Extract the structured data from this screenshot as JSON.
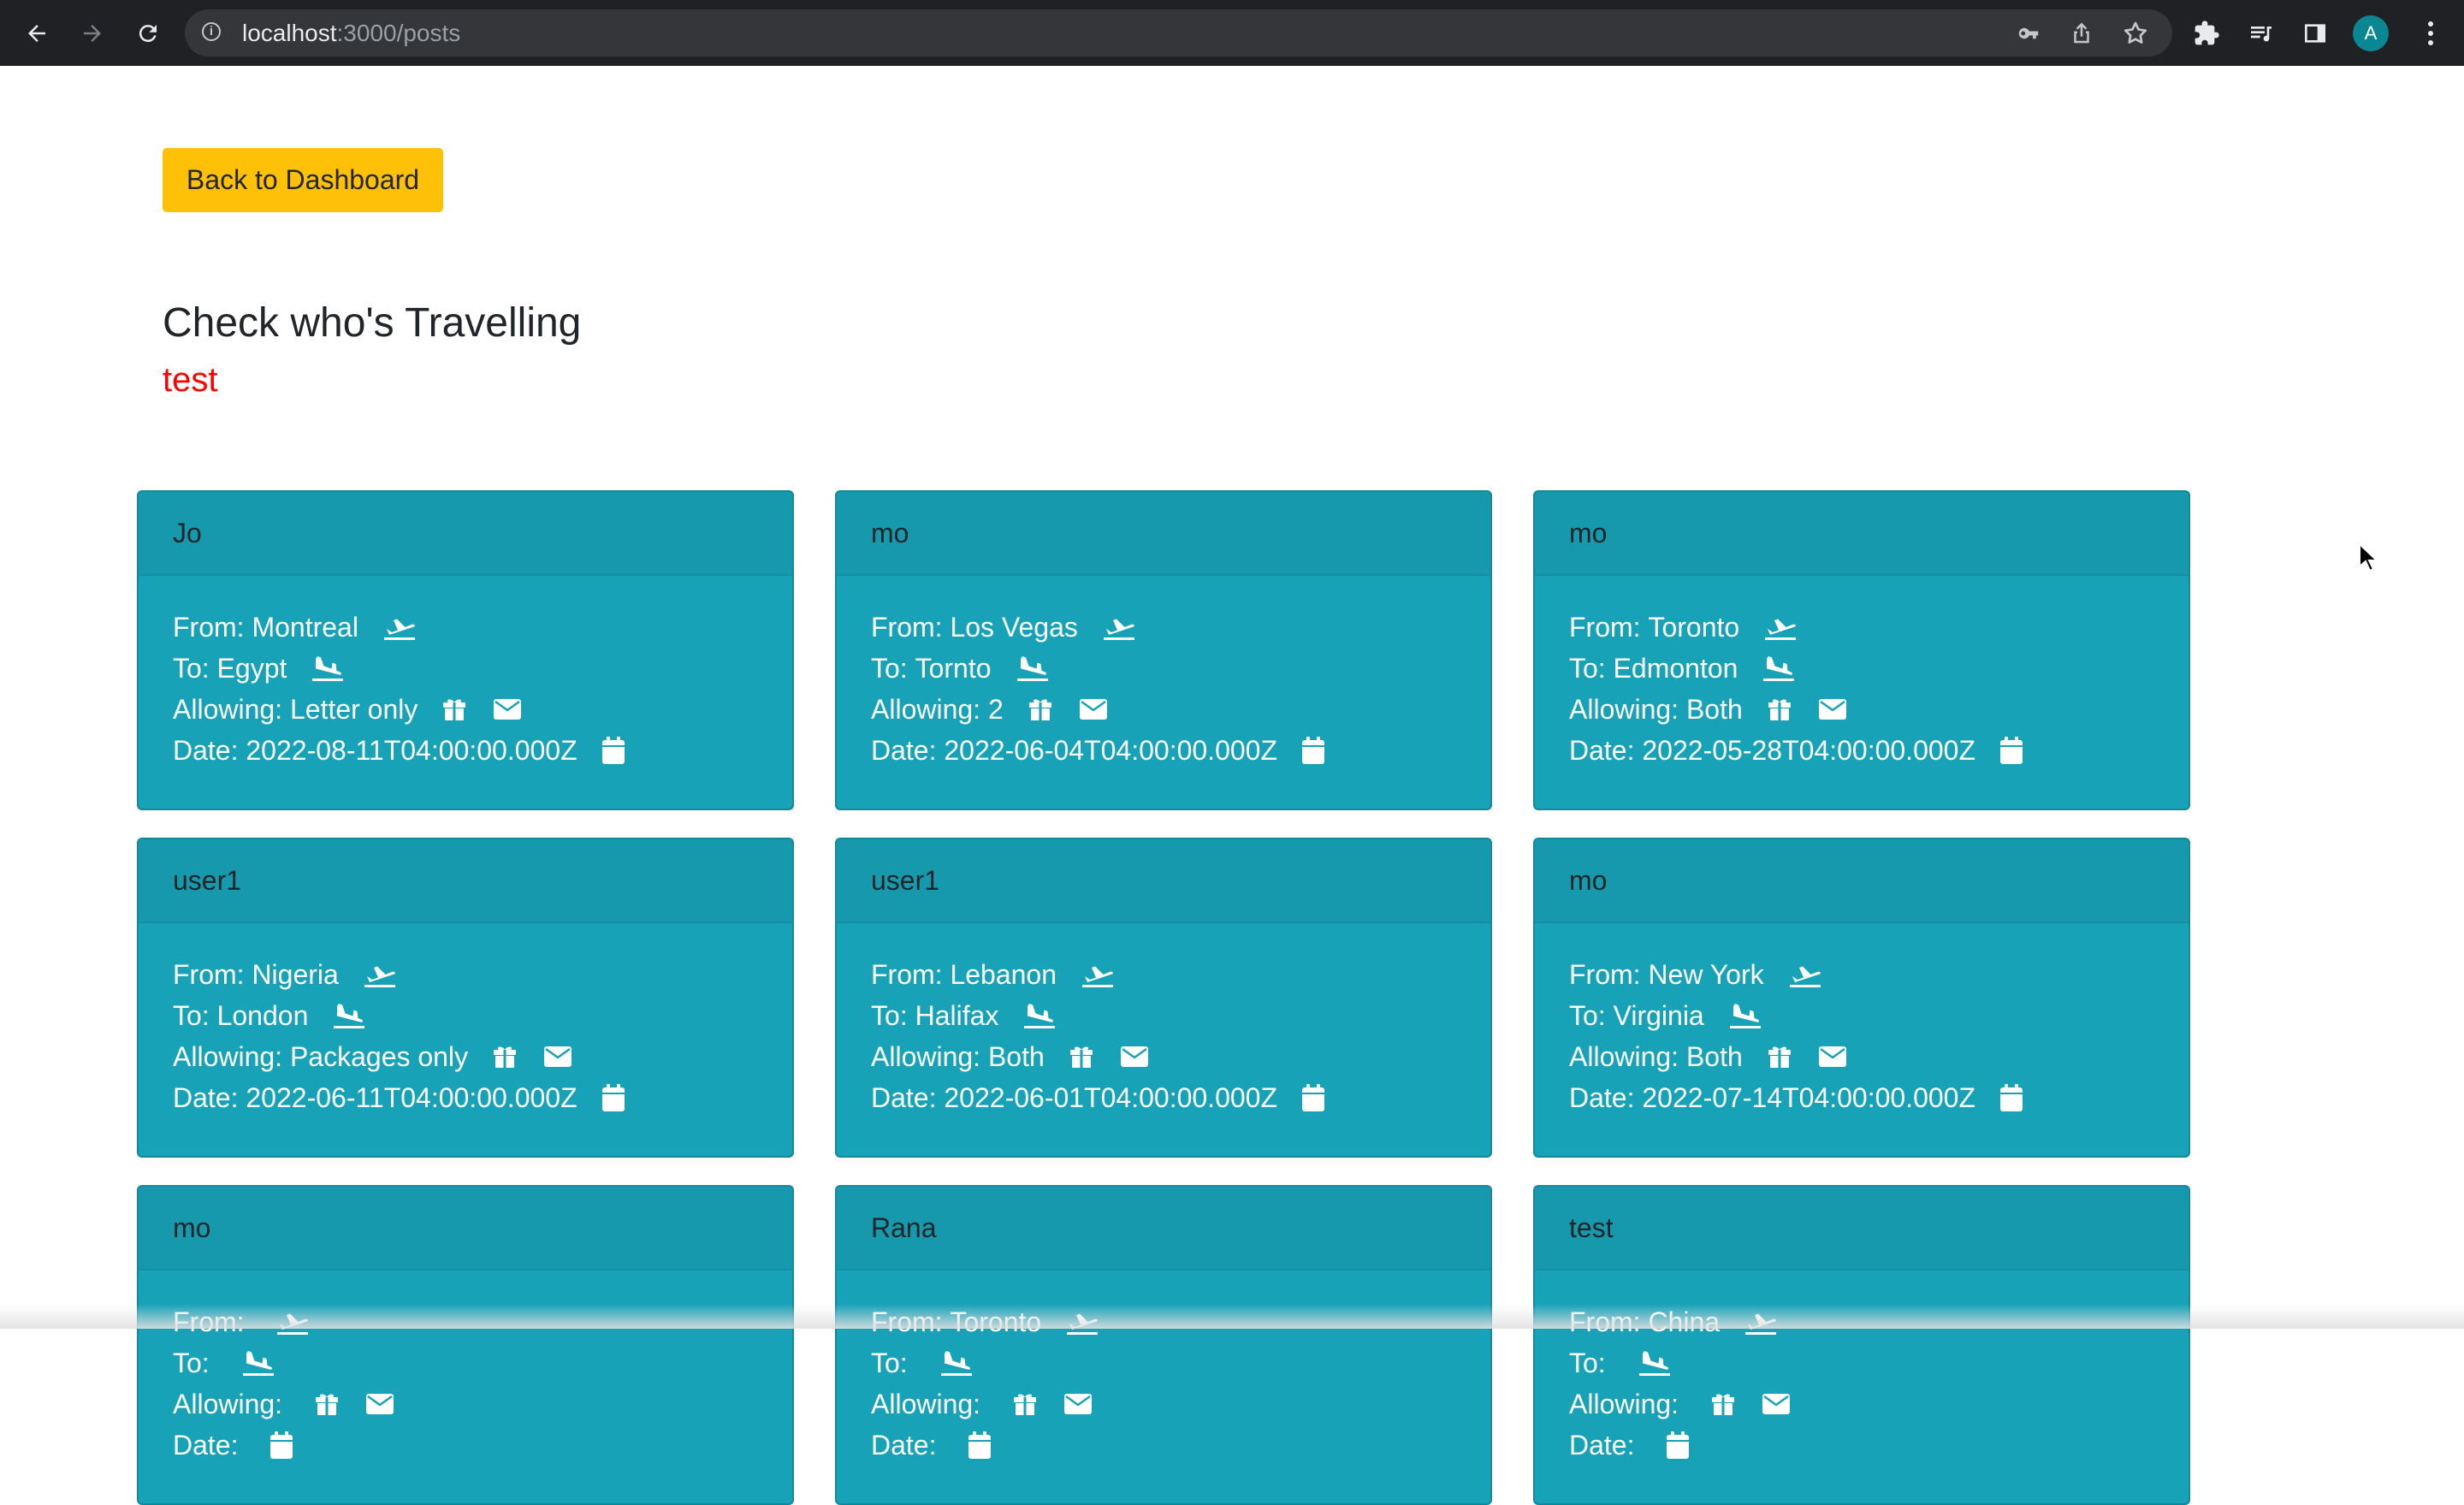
{
  "browser": {
    "url_host": "localhost",
    "url_path": ":3000/posts",
    "avatar_letter": "A"
  },
  "page": {
    "back_button_label": "Back to Dashboard",
    "title": "Check who's Travelling",
    "error_text": "test"
  },
  "labels": {
    "from": "From:",
    "to": "To:",
    "allowing": "Allowing:",
    "date": "Date:"
  },
  "colors": {
    "card_bg": "#17a2b8",
    "button_bg": "#ffc107",
    "error_text": "#ff0000"
  },
  "icons": [
    "plane-departure-icon",
    "plane-arrival-icon",
    "gift-icon",
    "envelope-icon",
    "calendar-icon"
  ],
  "posts": [
    {
      "user": "Jo",
      "from": "Montreal",
      "to": "Egypt",
      "allowing": "Letter only",
      "date": "2022-08-11T04:00:00.000Z"
    },
    {
      "user": "mo",
      "from": "Los Vegas",
      "to": "Tornto",
      "allowing": "2",
      "date": "2022-06-04T04:00:00.000Z"
    },
    {
      "user": "mo",
      "from": "Toronto",
      "to": "Edmonton",
      "allowing": "Both",
      "date": "2022-05-28T04:00:00.000Z"
    },
    {
      "user": "user1",
      "from": "Nigeria",
      "to": "London",
      "allowing": "Packages only",
      "date": "2022-06-11T04:00:00.000Z"
    },
    {
      "user": "user1",
      "from": "Lebanon",
      "to": "Halifax",
      "allowing": "Both",
      "date": "2022-06-01T04:00:00.000Z"
    },
    {
      "user": "mo",
      "from": "New York",
      "to": "Virginia",
      "allowing": "Both",
      "date": "2022-07-14T04:00:00.000Z"
    },
    {
      "user": "mo",
      "from": "",
      "to": "",
      "allowing": "",
      "date": ""
    },
    {
      "user": "Rana",
      "from": "Toronto",
      "to": "",
      "allowing": "",
      "date": ""
    },
    {
      "user": "test",
      "from": "China",
      "to": "",
      "allowing": "",
      "date": ""
    }
  ]
}
